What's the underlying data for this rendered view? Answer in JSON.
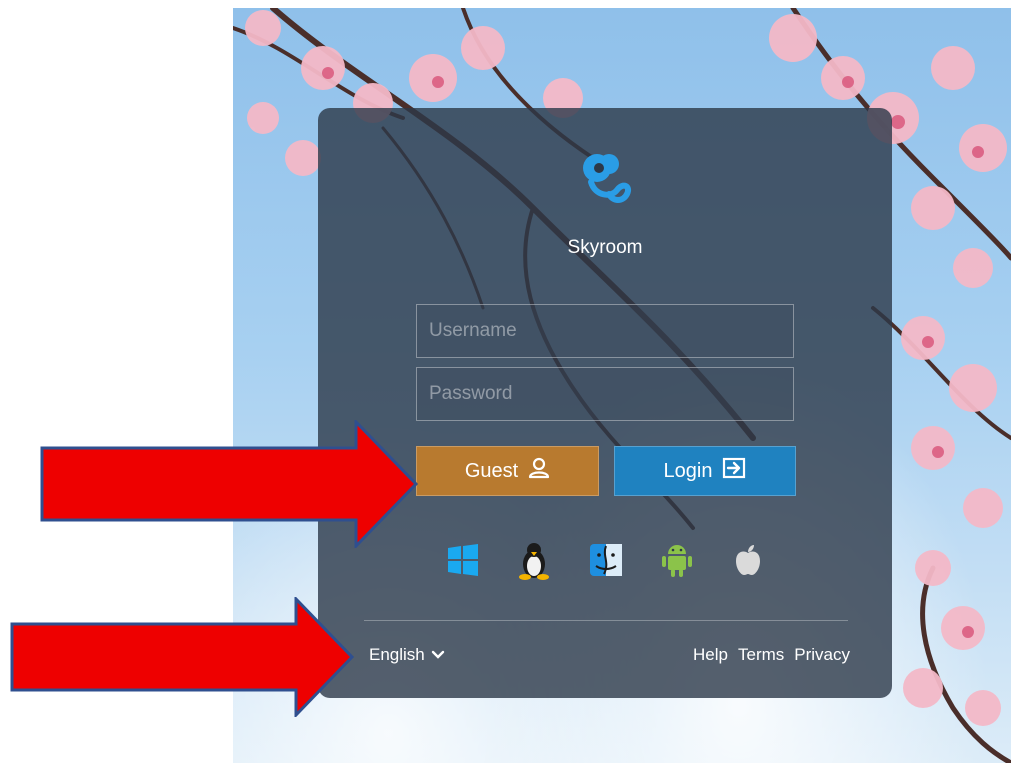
{
  "app": {
    "name": "Skyroom"
  },
  "login_form": {
    "username_placeholder": "Username",
    "password_placeholder": "Password",
    "guest_label": "Guest",
    "login_label": "Login"
  },
  "platforms": [
    "windows-icon",
    "linux-icon",
    "macos-finder-icon",
    "android-icon",
    "apple-icon"
  ],
  "footer": {
    "language": "English",
    "links": [
      "Help",
      "Terms",
      "Privacy"
    ]
  },
  "colors": {
    "guest_button": "#b87a2f",
    "login_button": "#1f82c0",
    "card": "#2c3848",
    "annotation_arrow": "#ee0000"
  }
}
